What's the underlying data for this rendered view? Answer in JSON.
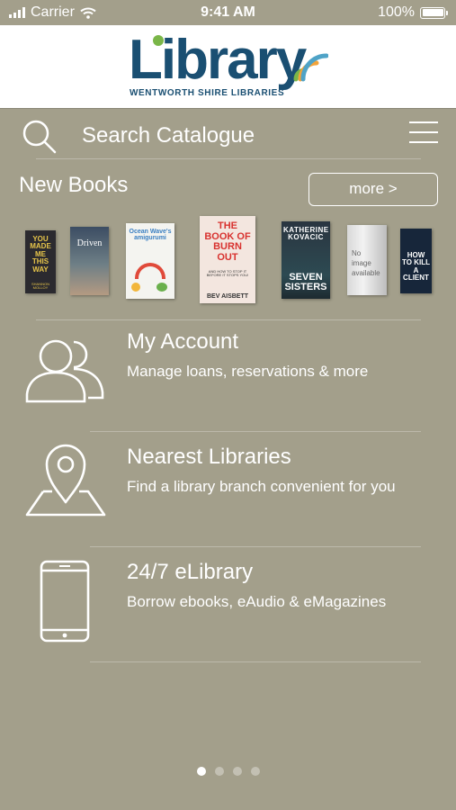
{
  "status_bar": {
    "carrier": "Carrier",
    "time": "9:41 AM",
    "battery": "100%"
  },
  "header": {
    "logo_text": "Library",
    "logo_subtitle": "WENTWORTH SHIRE LIBRARIES",
    "logo_color": "#1A4F72",
    "logo_accent_color": "#7AB648",
    "logo_arc_colors": [
      "#7AB648",
      "#F2A33A",
      "#4FA3C7"
    ]
  },
  "search": {
    "placeholder": "Search Catalogue",
    "icon": "search-icon",
    "menu_icon": "hamburger-menu-icon"
  },
  "new_books": {
    "title": "New Books",
    "more_label": "more >",
    "covers": [
      {
        "title_text": "YOU MADE ME THIS WAY",
        "author": "SHANNON MOLLOY"
      },
      {
        "title_text": "Driven",
        "author": ""
      },
      {
        "title_text": "Ocean Wave's amigurumi",
        "author": ""
      },
      {
        "title_text": "THE BOOK OF BURN OUT",
        "author": "BEV AISBETT",
        "tagline": "AND HOW TO STOP IT BEFORE IT STOPS YOU!"
      },
      {
        "title_text": "KATHERINE KOVACIC",
        "author": "SEVEN SISTERS"
      },
      {
        "title_text": "No image available",
        "author": ""
      },
      {
        "title_text": "HOW TO KILL A CLIENT",
        "author": ""
      }
    ]
  },
  "menu": [
    {
      "title": "My Account",
      "description": "Manage loans, reservations & more",
      "icon": "users-icon"
    },
    {
      "title": "Nearest Libraries",
      "description": "Find a library branch convenient for you",
      "icon": "map-pin-icon"
    },
    {
      "title": "24/7 eLibrary",
      "description": "Borrow ebooks, eAudio & eMagazines",
      "icon": "phone-icon"
    }
  ],
  "pager": {
    "pages": 4,
    "active_page": 1
  },
  "colors": {
    "background": "#A39F8B",
    "text": "#FFFFFF"
  }
}
